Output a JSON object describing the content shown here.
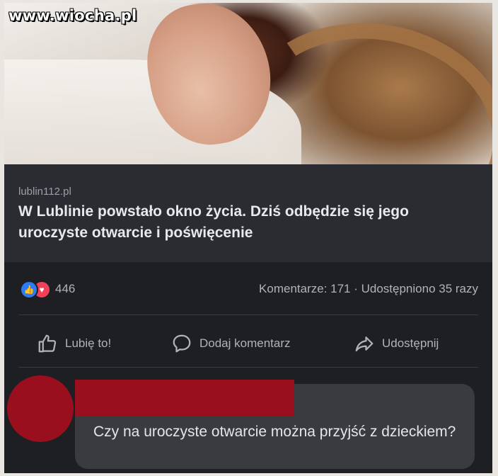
{
  "watermark": "www.wiocha.pl",
  "post": {
    "link_domain": "lublin112.pl",
    "headline": "W Lublinie powstało okno życia. Dziś odbędzie się jego uroczyste otwarcie i poświęcenie"
  },
  "stats": {
    "reactions": [
      {
        "icon": "like-reaction-icon",
        "color": "#2d7cf6"
      },
      {
        "icon": "love-reaction-icon",
        "color": "#f0405a"
      }
    ],
    "reaction_count": "446",
    "comments_shares": "Komentarze: 171 · Udostępniono 35 razy"
  },
  "actions": {
    "like": {
      "label": "Lubię to!",
      "icon": "thumbs-up-icon"
    },
    "comment": {
      "label": "Dodaj komentarz",
      "icon": "comment-icon"
    },
    "share": {
      "label": "Udostępnij",
      "icon": "share-arrow-icon"
    }
  },
  "comment": {
    "text": "Czy na uroczyste otwarcie można przyjść z dzieckiem?",
    "redaction_color": "#990f1e"
  }
}
